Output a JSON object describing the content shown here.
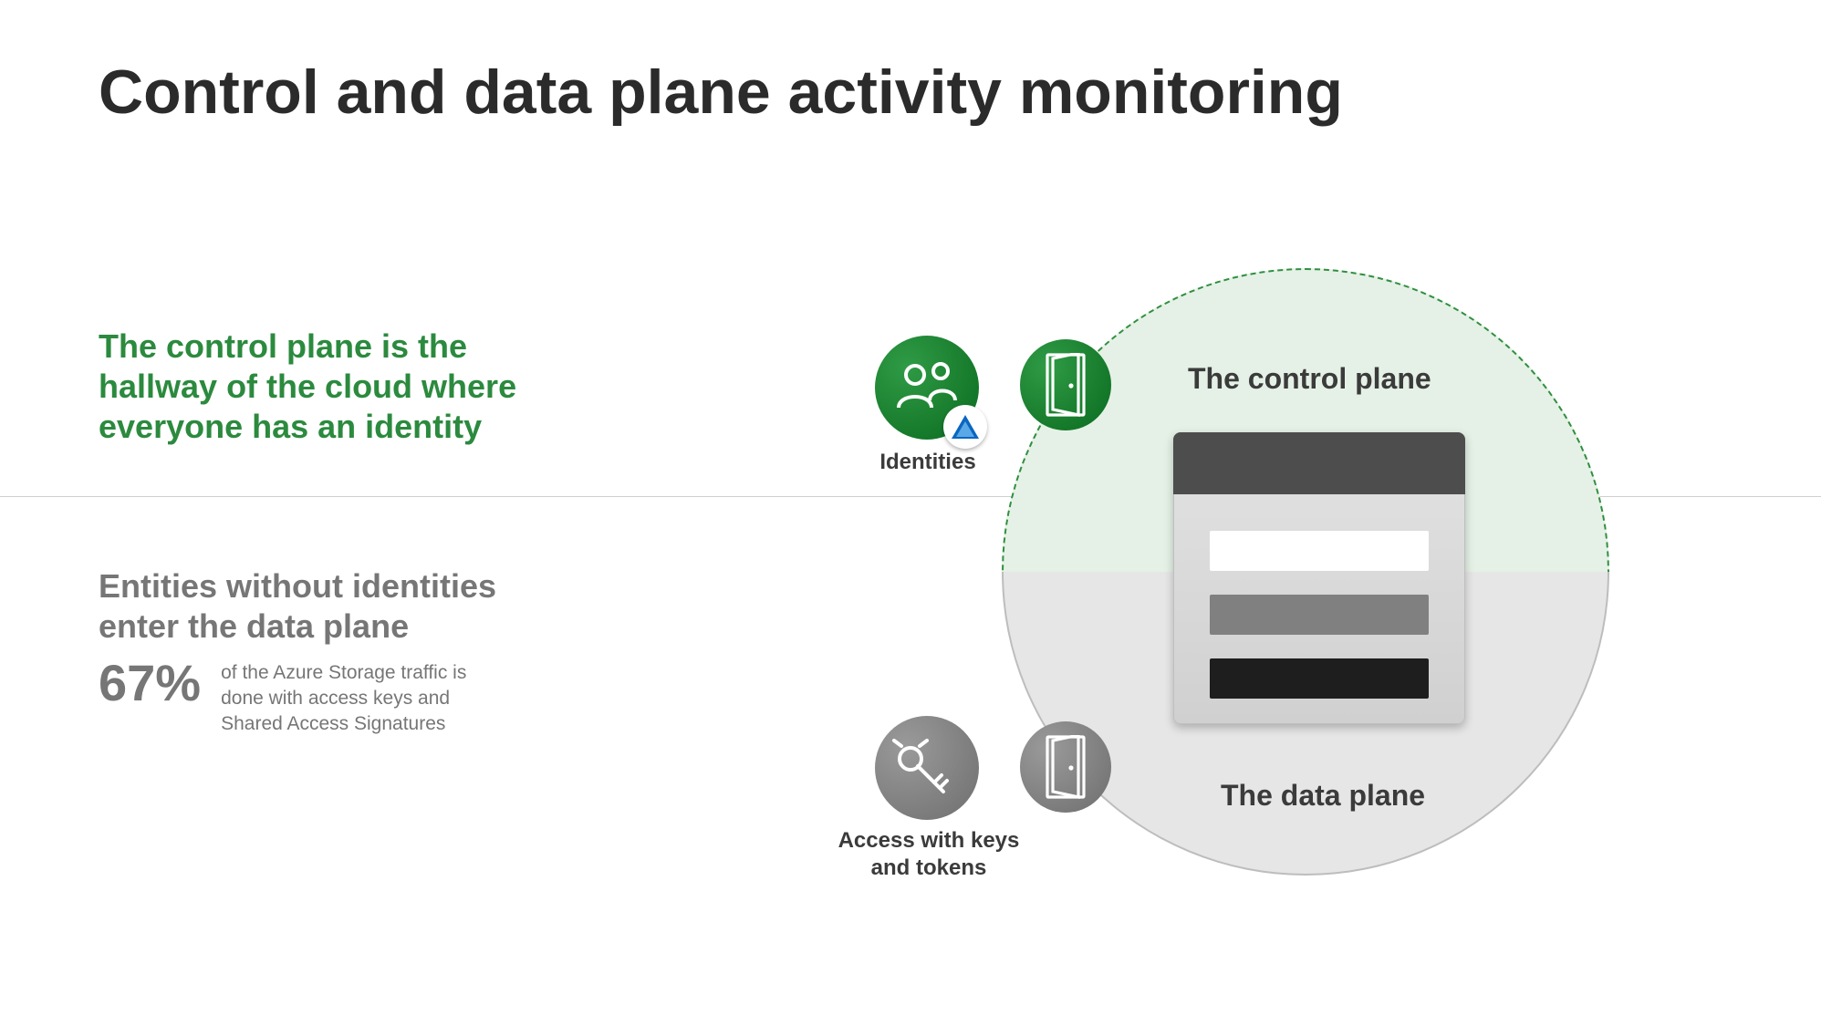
{
  "title": "Control and data plane activity monitoring",
  "sections": {
    "control": {
      "tagline": "The control plane is the hallway of the cloud where everyone has an identity",
      "circle_label": "The control plane",
      "icon_caption": "Identities"
    },
    "data": {
      "tagline": "Entities without identities enter the data plane",
      "stat_value": "67%",
      "stat_text": "of the Azure Storage traffic is done with access keys and Shared Access Signatures",
      "circle_label": "The data plane",
      "icon_caption": "Access with keys and tokens"
    }
  },
  "colors": {
    "accent_green": "#2b8a3e",
    "muted_gray": "#767676"
  }
}
